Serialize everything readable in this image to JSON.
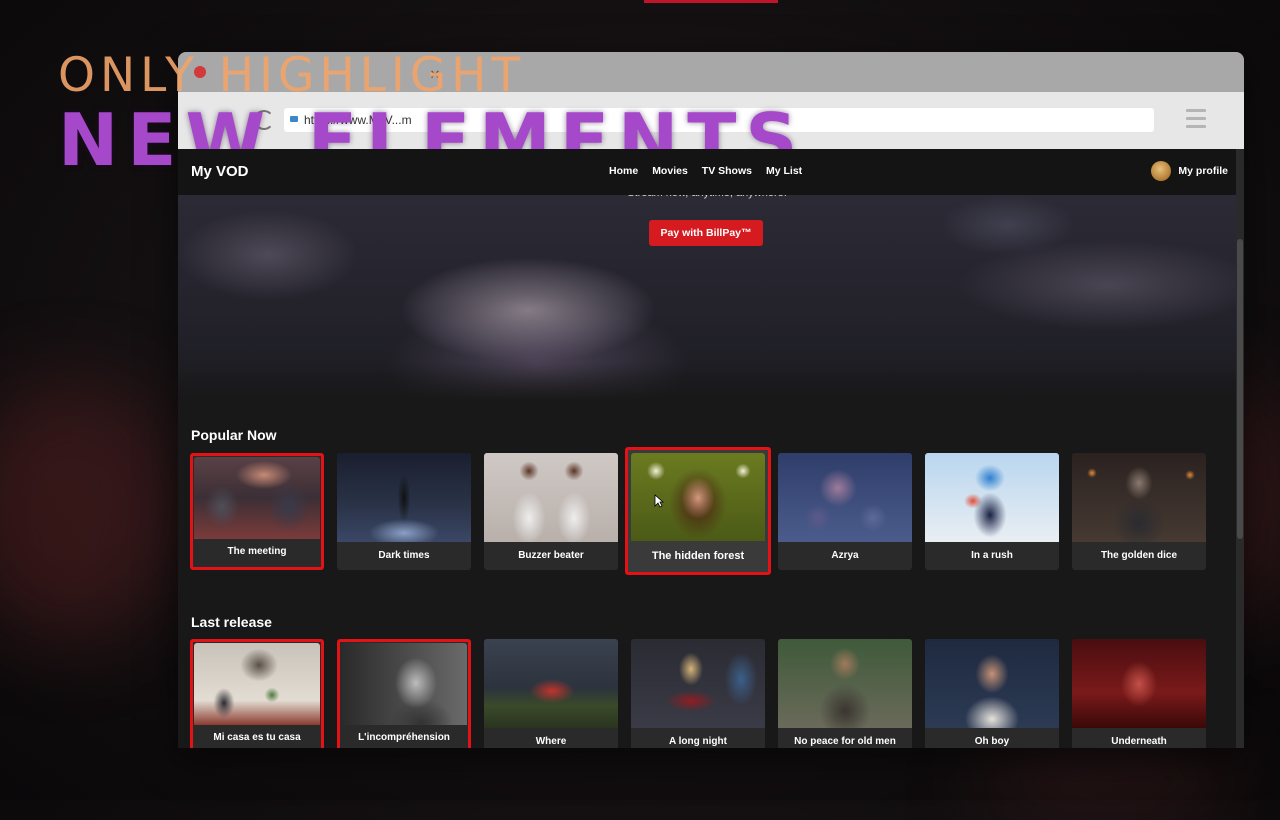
{
  "overlay": {
    "caption_top": "ONLY HIGHLIGHT",
    "caption_main": "NEW ELEMENTS"
  },
  "browser": {
    "url": "https://www.MyV...m"
  },
  "site": {
    "brand": "My VOD",
    "nav": [
      "Home",
      "Movies",
      "TV Shows",
      "My List"
    ],
    "profile_label": "My profile",
    "hero": {
      "tagline": "Stream now, anytime, anywhere.",
      "pay_button": "Pay with BillPay™"
    },
    "sections": [
      {
        "title": "Popular Now",
        "items": [
          {
            "label": "The meeting",
            "highlighted": true
          },
          {
            "label": "Dark times",
            "highlighted": false
          },
          {
            "label": "Buzzer beater",
            "highlighted": false
          },
          {
            "label": "The hidden forest",
            "highlighted": true,
            "hovered": true
          },
          {
            "label": "Azrya",
            "highlighted": false
          },
          {
            "label": "In a rush",
            "highlighted": false
          },
          {
            "label": "The golden dice",
            "highlighted": false
          }
        ]
      },
      {
        "title": "Last release",
        "items": [
          {
            "label": "Mi casa es tu casa",
            "highlighted": true
          },
          {
            "label": "L'incompréhension",
            "highlighted": true
          },
          {
            "label": "Where",
            "highlighted": false
          },
          {
            "label": "A long night",
            "highlighted": false
          },
          {
            "label": "No peace for old men",
            "highlighted": false
          },
          {
            "label": "Oh boy",
            "highlighted": false
          },
          {
            "label": "Underneath",
            "highlighted": false
          }
        ]
      }
    ]
  },
  "colors": {
    "accent_red": "#d61b20",
    "highlight_border": "#e31216",
    "caption_orange": "#f2a46a",
    "caption_purple": "#a548c9"
  }
}
